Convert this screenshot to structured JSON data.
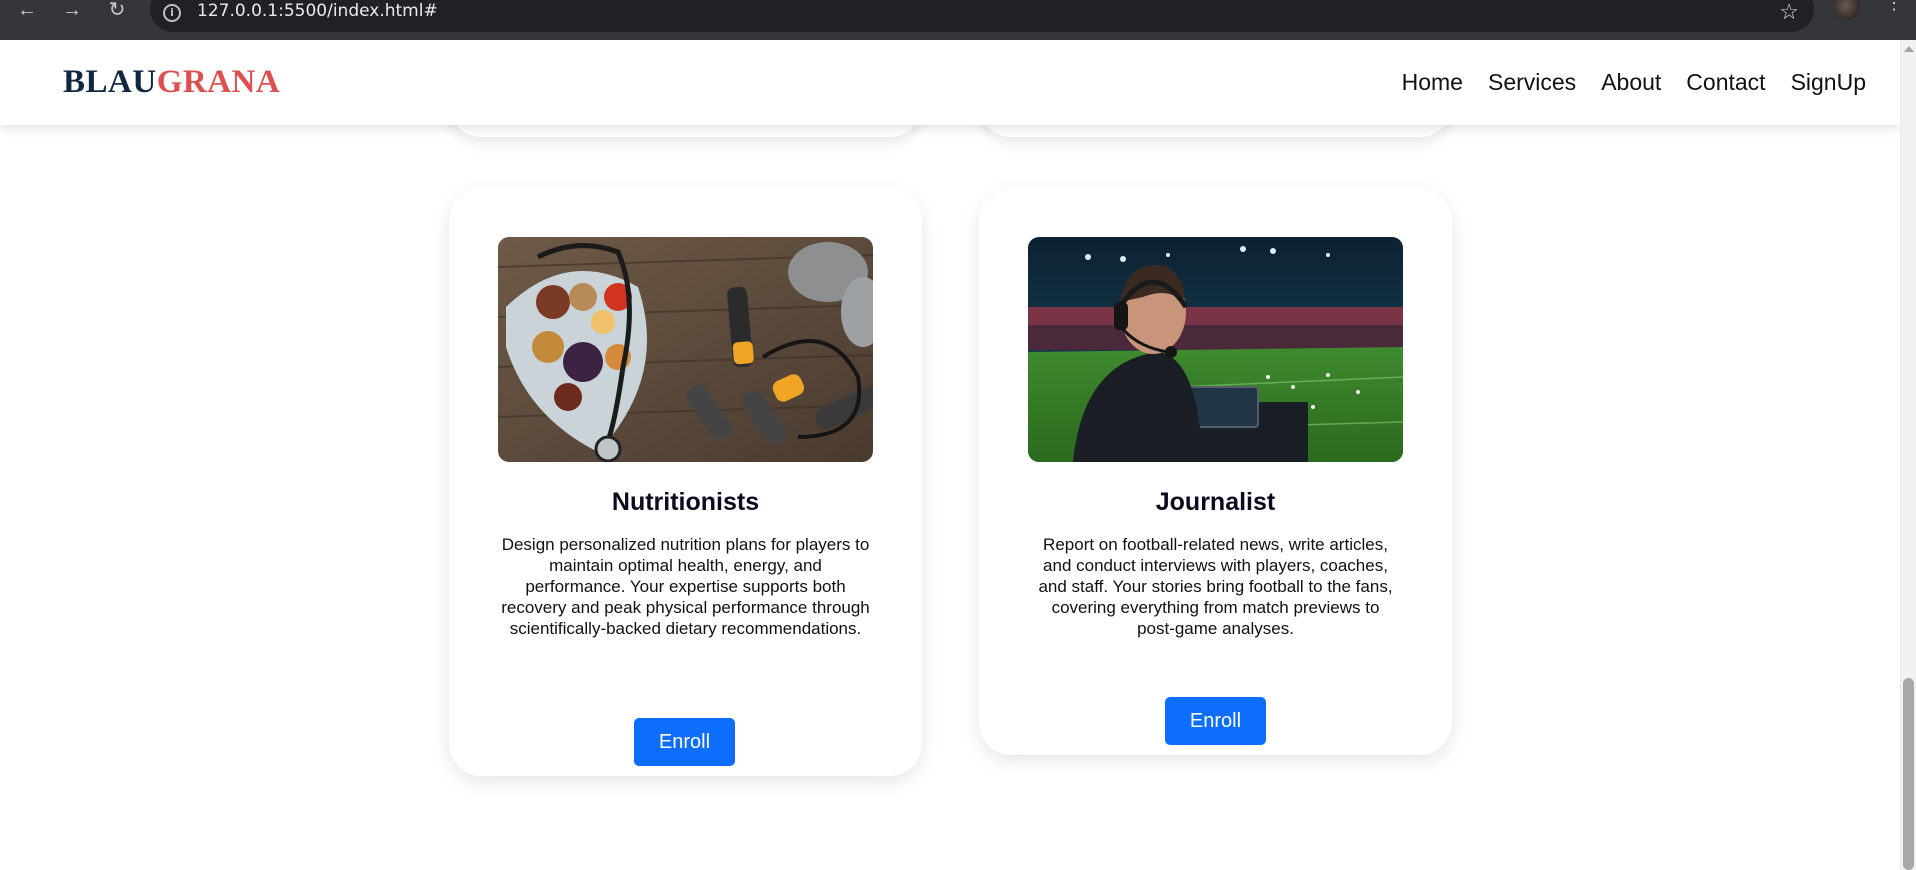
{
  "browser": {
    "back_icon": "←",
    "forward_icon": "→",
    "reload_icon": "↻",
    "url": "127.0.0.1:5500/index.html#",
    "bookmark_icon": "☆",
    "menu_icon": "⋮"
  },
  "navbar": {
    "logo_part1": "BLAU",
    "logo_part2": "GRANA",
    "links": [
      "Home",
      "Services",
      "About",
      "Contact",
      "SignUp"
    ]
  },
  "cards": [
    {
      "title": "Nutritionists",
      "description": "Design personalized nutrition plans for players to maintain optimal health, energy, and performance. Your expertise supports both recovery and peak physical performance through scientifically-backed dietary recommendations.",
      "button": "Enroll"
    },
    {
      "title": "Journalist",
      "description": "Report on football-related news, write articles, and conduct interviews with players, coaches, and staff. Your stories bring football to the fans, covering everything from match previews to post-game analyses.",
      "button": "Enroll"
    }
  ],
  "colors": {
    "logo_dark": "#0f2741",
    "logo_red": "#de4f4f",
    "button_blue": "#0d6efd"
  }
}
